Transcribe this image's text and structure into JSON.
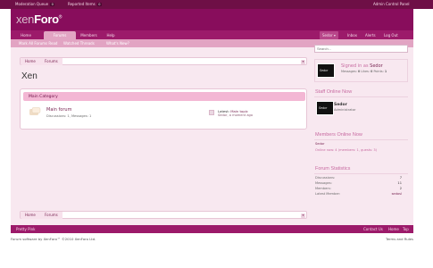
{
  "admin_bar": {
    "moderation_queue": "Moderation Queue",
    "moderation_count": "0",
    "reported_items": "Reported Items",
    "reported_count": "0",
    "admin_cp": "Admin Control Panel"
  },
  "logo": {
    "part1": "xen",
    "part2": "Foro",
    "tm": "®"
  },
  "nav": {
    "tabs": [
      "Home",
      "Forums",
      "Members",
      "Help"
    ],
    "active": "Forums",
    "user": "Sedor",
    "inbox": "Inbox",
    "alerts": "Alerts",
    "logout": "Log Out"
  },
  "subnav": [
    "Mark All Forums Read",
    "Watched Threads",
    "What's New?"
  ],
  "search": {
    "placeholder": "Search..."
  },
  "breadcrumb": [
    "Home",
    "Forums"
  ],
  "page_title": "Xen",
  "category": {
    "title": "Main Category",
    "forum": {
      "title": "Main forum",
      "discussions_label": "Discussions:",
      "discussions": "1",
      "messages_label": "Messages:",
      "messages": "1",
      "latest_label": "Latest:",
      "latest_title": "Main topic",
      "latest_by": "Sedor",
      "latest_time": "a moment ago"
    }
  },
  "signed_in": {
    "prefix": "Signed in as",
    "user": "Sedor",
    "messages_label": "Messages:",
    "messages": "0",
    "likes_label": "Likes:",
    "likes": "0",
    "points_label": "Points:",
    "points": "1"
  },
  "staff_online": {
    "title": "Staff Online Now",
    "name": "Sedor",
    "role": "Administrator"
  },
  "members_online": {
    "title": "Members Online Now",
    "names": "Sedor",
    "summary": "Online now: 4 (members: 1, guests: 3)"
  },
  "forum_stats": {
    "title": "Forum Statistics",
    "rows": [
      {
        "label": "Discussions:",
        "value": "7"
      },
      {
        "label": "Messages:",
        "value": "11"
      },
      {
        "label": "Members:",
        "value": "2"
      },
      {
        "label": "Latest Member:",
        "value": "sedosl"
      }
    ]
  },
  "avatar_text": "Sedor",
  "bottom_bar": {
    "left": "Pretty Pink",
    "contact": "Contact Us",
    "home": "Home",
    "top": "Top"
  },
  "footer": {
    "copyright": "Forum software by XenForo™ ©2010 XenForo Ltd.",
    "terms": "Terms and Rules"
  },
  "colors": {
    "brand": "#880d5c",
    "nav": "#9c1a6a",
    "accent": "#e2a4c3",
    "panel": "#f8e8f0"
  }
}
